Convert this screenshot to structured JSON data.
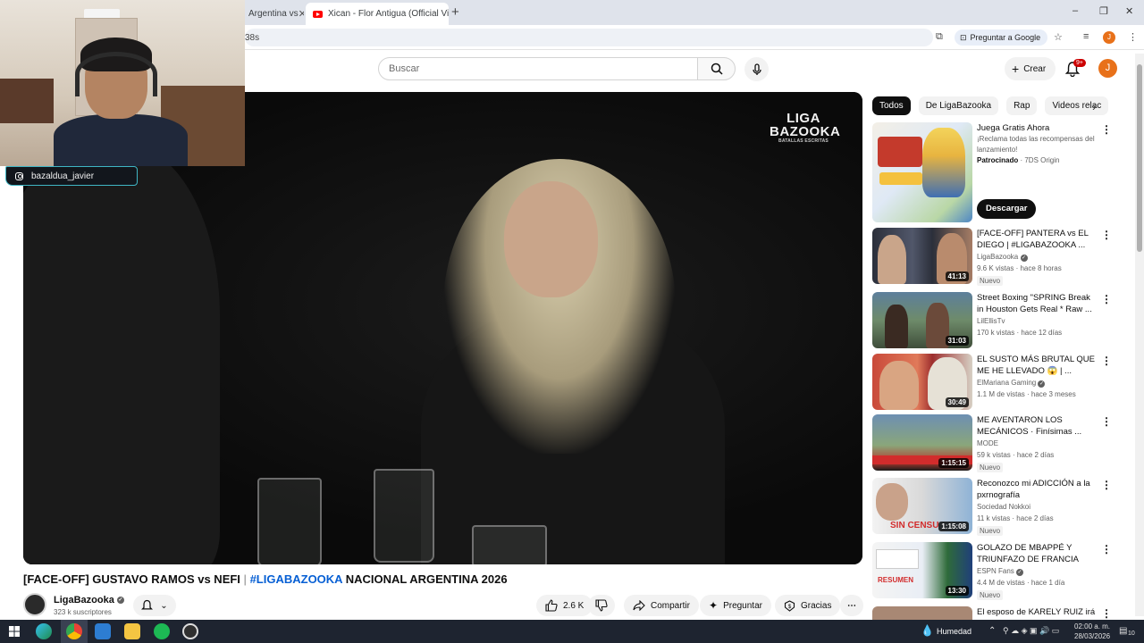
{
  "browser": {
    "tabs": [
      {
        "label": "Argentina vs"
      },
      {
        "label": "Xican - Flor Antigua (Official Vi"
      }
    ],
    "address_fragment": "38s",
    "ask_google": "Preguntar a Google",
    "profile_letter": "J"
  },
  "header": {
    "search_placeholder": "Buscar",
    "create_label": "Crear",
    "notifications_badge": "9+",
    "avatar_letter": "J"
  },
  "webcam": {
    "instagram_handle": "bazaldua_javier"
  },
  "video": {
    "logo_line1": "LIGA",
    "logo_line2": "BAZOOKA",
    "logo_tagline": "BATALLAS ESCRITAS",
    "title_part1": "[FACE-OFF] GUSTAVO RAMOS vs NEFI",
    "title_sep": "|",
    "title_hashtag": "#LIGABAZOOKA",
    "title_part2": "NACIONAL ARGENTINA 2026",
    "channel_name": "LigaBazooka",
    "subscribers": "323 k suscriptores",
    "likes": "2.6 K",
    "share_label": "Compartir",
    "ask_label": "Preguntar",
    "thanks_label": "Gracias"
  },
  "sidebar": {
    "chips": [
      "Todos",
      "De LigaBazooka",
      "Rap",
      "Videos relac"
    ],
    "ad": {
      "title": "Juega Gratis Ahora",
      "description": "¡Reclama todas las recompensas del lanzamiento!",
      "sponsor_label": "Patrocinado",
      "advertiser": "7DS Origin",
      "cta": "Descargar"
    },
    "recommendations": [
      {
        "title": "[FACE-OFF] PANTERA vs EL DIEGO | #LIGABAZOOKA ...",
        "channel": "LigaBazooka",
        "meta": "9.6 K vistas · hace 8 horas",
        "badge": "Nuevo",
        "duration": "41:13"
      },
      {
        "title": "Street Boxing \"SPRING Break in Houston Gets Real * Raw ...",
        "channel": "LilEllisTv",
        "meta": "170 k vistas · hace 12 días",
        "badge": "",
        "duration": "31:03"
      },
      {
        "title": "EL SUSTO MÁS BRUTAL QUE ME HE LLEVADO 😱 | ...",
        "channel": "ElMariana Gaming",
        "meta": "1.1 M de vistas · hace 3 meses",
        "badge": "",
        "duration": "30:49"
      },
      {
        "title": "ME AVENTARON LOS MECÁNICOS · Finísimas ...",
        "channel": "MODE",
        "meta": "59 k vistas · hace 2 días",
        "badge": "Nuevo",
        "duration": "1:15:15"
      },
      {
        "title": "Reconozco mi ADICCIÓN a la pxrnografía",
        "channel": "Sociedad Nokkoi",
        "meta": "11 k vistas · hace 2 días",
        "badge": "Nuevo",
        "duration": "1:15:08"
      },
      {
        "title": "GOLAZO DE MBAPPÉ Y TRIUNFAZO DE FRANCIA ANT...",
        "channel": "ESPN Fans",
        "meta": "4.4 M de vistas · hace 1 día",
        "badge": "Nuevo",
        "duration": "13:30"
      },
      {
        "title": "El esposo de KARELY RUIZ irá a",
        "channel": "",
        "meta": "",
        "badge": "",
        "duration": ""
      }
    ],
    "thumb_text_2": "SIN CENSU",
    "thumb_text_3": "RESUMEN"
  },
  "taskbar": {
    "weather": "Humedad",
    "time": "02:00 a. m.",
    "date": "28/03/2026",
    "notif_count": "10"
  },
  "colors": {
    "brand_red": "#ff0000",
    "link_blue": "#065fd4",
    "avatar_orange": "#e8711a",
    "webcam_border": "#3fb6c5"
  }
}
